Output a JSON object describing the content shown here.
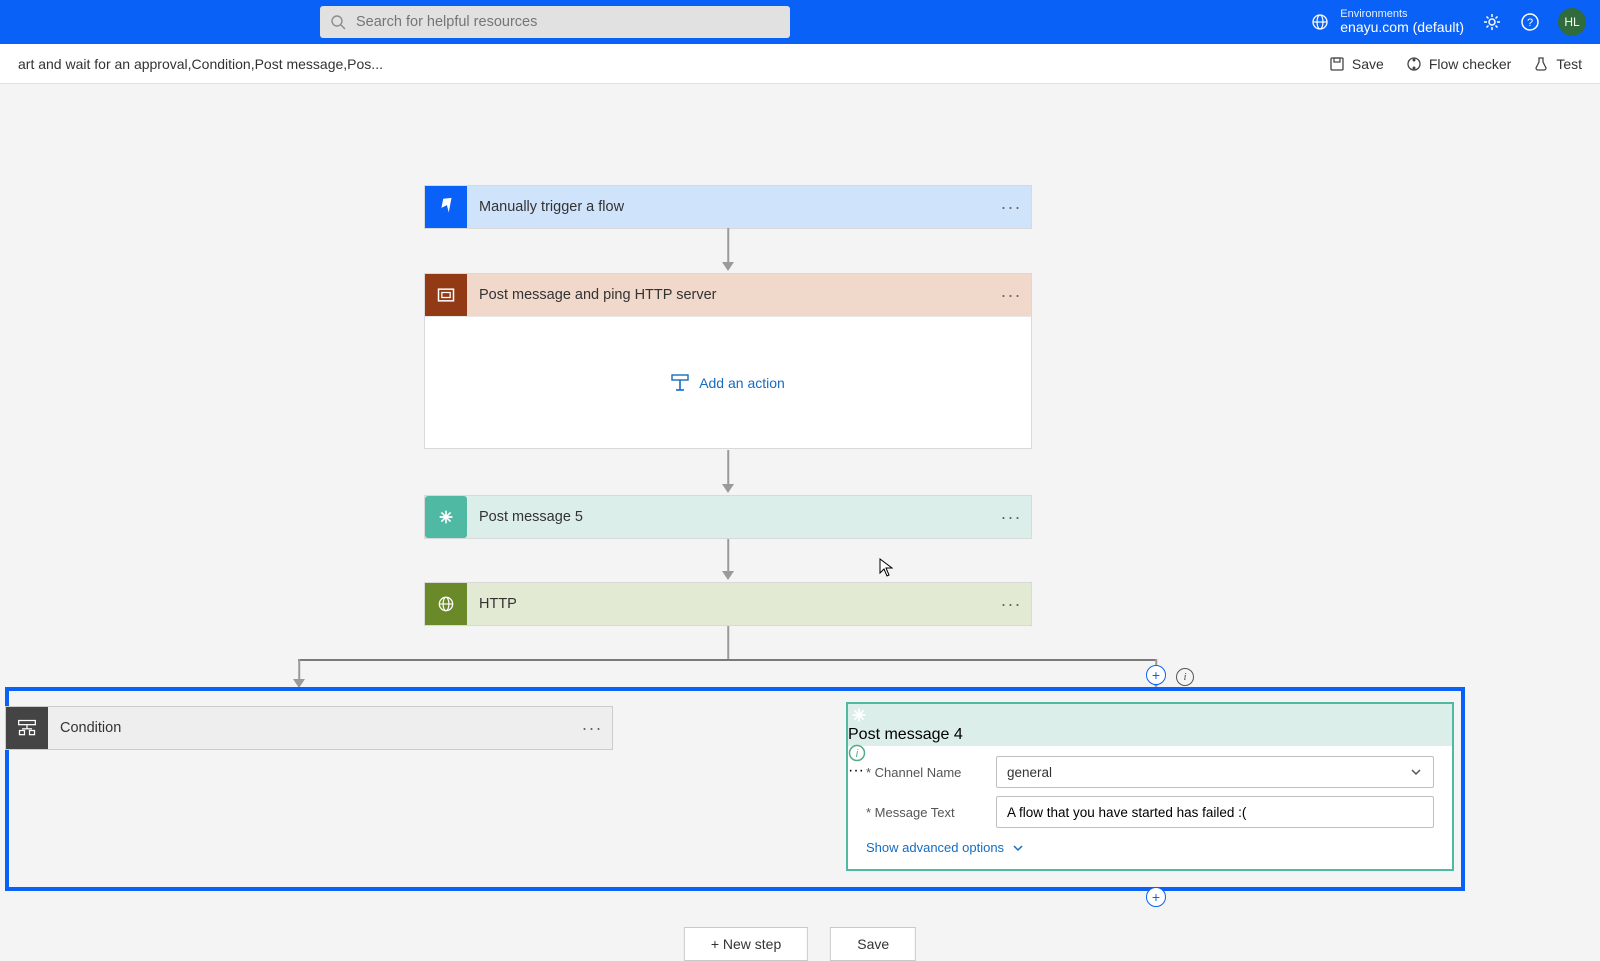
{
  "topbar": {
    "search_placeholder": "Search for helpful resources",
    "env_label": "Environments",
    "env_value": "enayu.com (default)",
    "avatar_initials": "HL"
  },
  "cmdbar": {
    "breadcrumb": "art and wait for an approval,Condition,Post message,Pos...",
    "save": "Save",
    "flow_checker": "Flow checker",
    "test": "Test"
  },
  "steps": {
    "trigger": "Manually trigger a flow",
    "scope": "Post message and ping HTTP server",
    "add_action": "Add an action",
    "post5": "Post message 5",
    "http": "HTTP",
    "condition": "Condition",
    "post4": {
      "title": "Post message 4",
      "channel_label": "Channel Name",
      "channel_value": "general",
      "msg_label": "Message Text",
      "msg_value": "A flow that you have started has failed :(",
      "adv": "Show advanced options"
    }
  },
  "footer": {
    "new_step": "+ New step",
    "save": "Save"
  }
}
